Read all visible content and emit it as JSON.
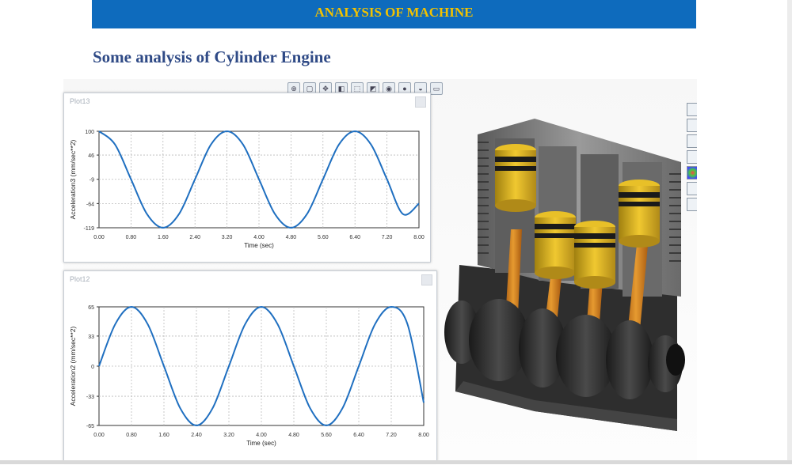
{
  "banner": {
    "title": "ANALYSIS OF MACHINE"
  },
  "page": {
    "heading": "Some analysis of Cylinder Engine"
  },
  "toolbar": {
    "icons": [
      "zoom-fit-icon",
      "zoom-area-icon",
      "pan-icon",
      "section-view-icon",
      "view-orientation-icon",
      "display-style-icon",
      "hide-show-icon",
      "edit-appearance-icon",
      "scene-icon",
      "view-settings-icon"
    ]
  },
  "side_toolbar": {
    "icons": [
      "home-icon",
      "3d-view-icon",
      "folder-icon",
      "appearance-icon",
      "color-wheel-icon",
      "display-manager-icon",
      "custom-properties-icon"
    ]
  },
  "plots": [
    {
      "window_title": "Plot13"
    },
    {
      "window_title": "Plot12"
    }
  ],
  "colors": {
    "banner_bg": "#0e6bbd",
    "banner_text": "#f2c200",
    "heading": "#2f4a86",
    "series": "#1f6fc0"
  },
  "chart_data": [
    {
      "type": "line",
      "title": "",
      "xlabel": "Time (sec)",
      "ylabel": "Acceleration3 (mm/sec**2)",
      "xlim": [
        0,
        8
      ],
      "ylim": [
        -119,
        100
      ],
      "x_ticks": [
        "0.00",
        "0.80",
        "1.60",
        "2.40",
        "3.20",
        "4.00",
        "4.80",
        "5.60",
        "6.40",
        "7.20",
        "8.00"
      ],
      "y_ticks": [
        100,
        46,
        -9,
        -64,
        -119
      ],
      "y_tick_labels": [
        "100",
        "46",
        "-9",
        "-64",
        "-119"
      ],
      "grid": true,
      "series": [
        {
          "x": [
            0,
            0.4,
            0.8,
            1.2,
            1.6,
            2.0,
            2.4,
            2.8,
            3.2,
            3.6,
            4.0,
            4.4,
            4.8,
            5.2,
            5.6,
            6.0,
            6.4,
            6.8,
            7.2,
            7.6,
            8.0
          ],
          "y": [
            100,
            70,
            -9,
            -88,
            -119,
            -88,
            -9,
            70,
            100,
            70,
            -9,
            -88,
            -119,
            -88,
            -9,
            70,
            100,
            70,
            -9,
            -88,
            -64
          ]
        }
      ]
    },
    {
      "type": "line",
      "title": "",
      "xlabel": "Time (sec)",
      "ylabel": "Acceleration2 (mm/sec**2)",
      "xlim": [
        0,
        8
      ],
      "ylim": [
        -65,
        65
      ],
      "x_ticks": [
        "0.00",
        "0.80",
        "1.60",
        "2.40",
        "3.20",
        "4.00",
        "4.80",
        "5.60",
        "6.40",
        "7.20",
        "8.00"
      ],
      "y_ticks": [
        65,
        33,
        0,
        -33,
        -65
      ],
      "y_tick_labels": [
        "65",
        "33",
        "0",
        "-33",
        "-65"
      ],
      "grid": true,
      "series": [
        {
          "x": [
            0,
            0.4,
            0.8,
            1.2,
            1.6,
            2.0,
            2.4,
            2.8,
            3.2,
            3.6,
            4.0,
            4.4,
            4.8,
            5.2,
            5.6,
            6.0,
            6.4,
            6.8,
            7.2,
            7.6,
            8.0
          ],
          "y": [
            0,
            46,
            65,
            46,
            0,
            -46,
            -65,
            -46,
            0,
            46,
            65,
            46,
            0,
            -46,
            -65,
            -46,
            0,
            46,
            65,
            46,
            -40
          ]
        }
      ]
    }
  ]
}
